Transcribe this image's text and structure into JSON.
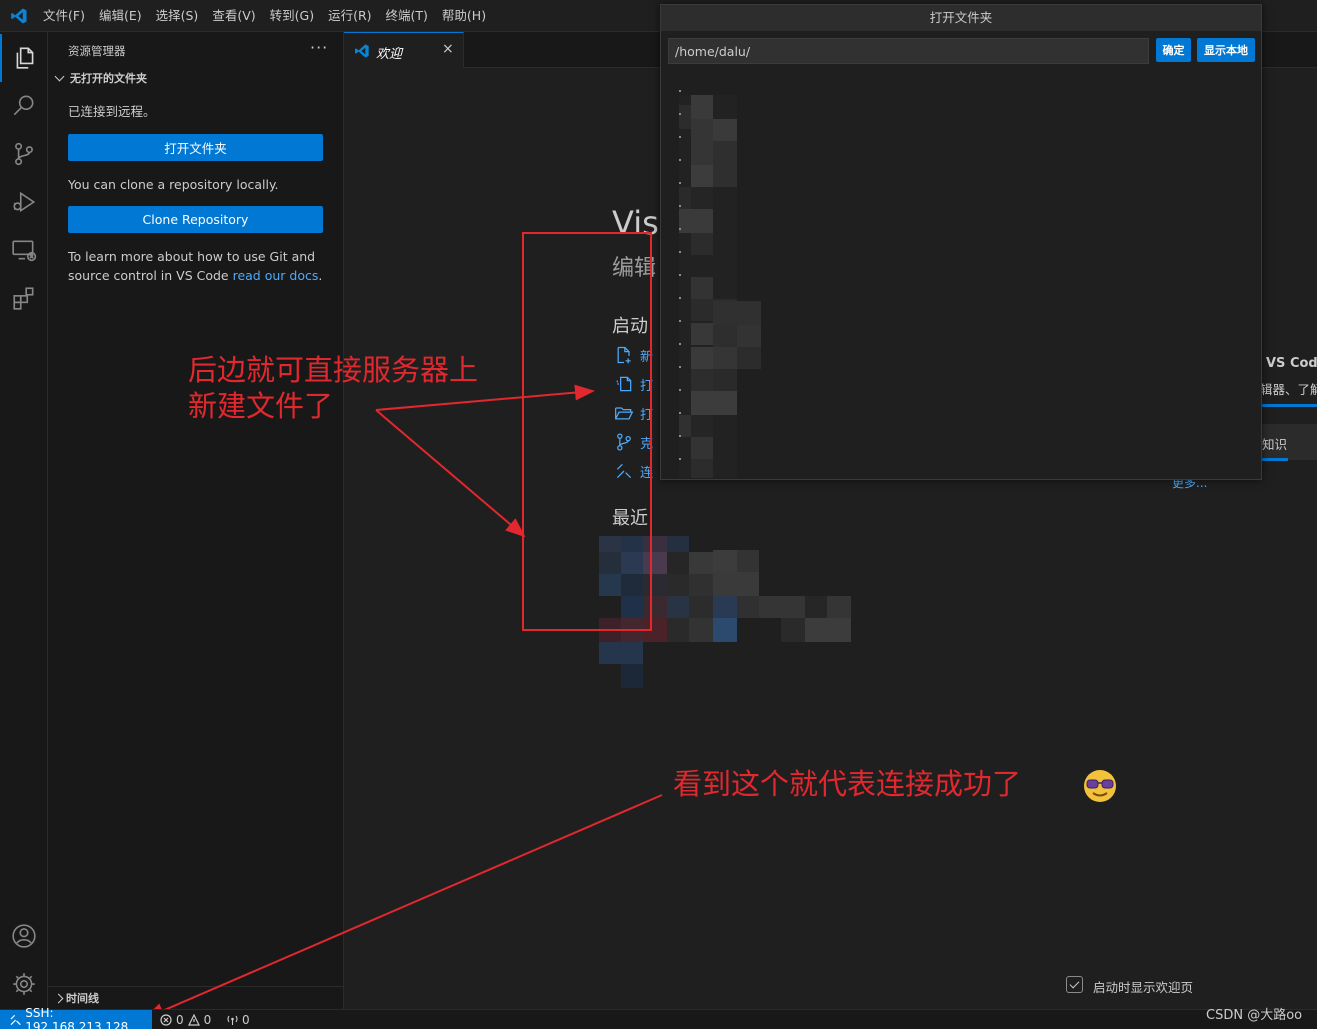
{
  "menu": [
    "文件(F)",
    "编辑(E)",
    "选择(S)",
    "查看(V)",
    "转到(G)",
    "运行(R)",
    "终端(T)",
    "帮助(H)"
  ],
  "activity_bar": {
    "items": [
      "explorer-icon",
      "search-icon",
      "source-control-icon",
      "run-debug-icon",
      "remote-explorer-icon",
      "extensions-icon"
    ],
    "bottom": [
      "account-icon",
      "settings-gear-icon"
    ]
  },
  "sidebar": {
    "title": "资源管理器",
    "more": "···",
    "section": "无打开的文件夹",
    "connected": "已连接到远程。",
    "open_folder_button": "打开文件夹",
    "clone_text": "You can clone a repository locally.",
    "clone_button": "Clone Repository",
    "learn_text": "To learn more about how to use Git and source control in VS Code ",
    "learn_link": "read our docs",
    "learn_end": ".",
    "timeline": "时间线"
  },
  "tab": {
    "label": "欢迎",
    "close": "×"
  },
  "welcome": {
    "title": "Vis",
    "subtitle": "编辑",
    "start_heading": "启动",
    "start_items": [
      "新",
      "打",
      "打",
      "克",
      "连"
    ],
    "recent_heading": "最近",
    "right_title": "VS Code",
    "right_desc": "辑器、了解",
    "right_card": "知识",
    "more_link": "更多...",
    "show_on_startup": "启动时显示欢迎页"
  },
  "dialog": {
    "title": "打开文件夹",
    "path_value": "/home/dalu/",
    "ok_button": "确定",
    "show_local_button": "显示本地"
  },
  "annotations": {
    "note1_line1": "后边就可直接服务器上",
    "note1_line2": "新建文件了",
    "note2": "看到这个就代表连接成功了",
    "color": "#e0282e"
  },
  "statusbar": {
    "remote": "SSH: 192.168.213.128",
    "errors": "0",
    "warnings": "0",
    "ports": "0"
  },
  "watermark": "CSDN @大路oo",
  "colors": {
    "accent": "#0078d4",
    "link": "#4daafc",
    "background": "#1f1f1f",
    "sidebar": "#181818"
  }
}
